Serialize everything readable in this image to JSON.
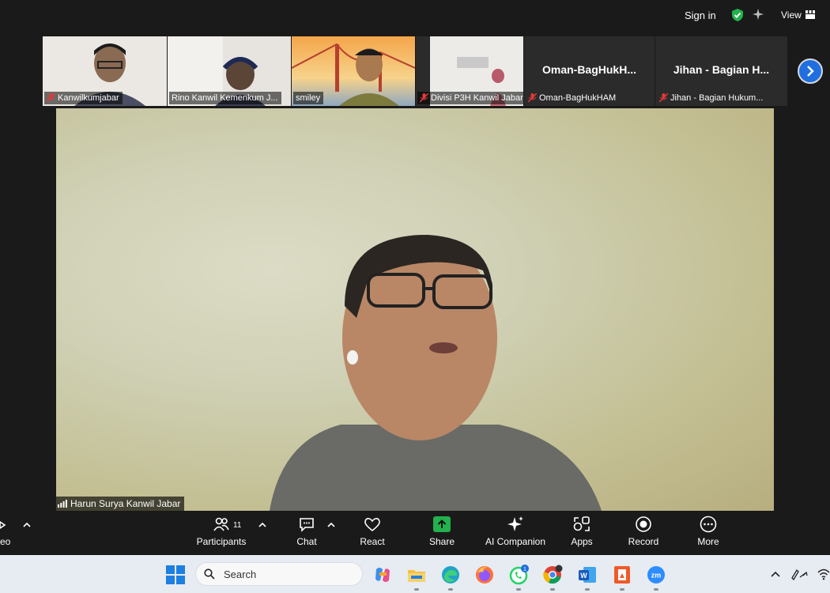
{
  "topbar": {
    "signin": "Sign in",
    "view": "View"
  },
  "thumbnails": [
    {
      "label": "Kanwilkumjabar",
      "muted": true
    },
    {
      "label": "Rino Kanwil Kemenkum J...",
      "muted": false
    },
    {
      "label": "smiley",
      "muted": false
    },
    {
      "label": "Divisi P3H Kanwil Jabar",
      "muted": true
    },
    {
      "label": "Oman-BagHukHAM",
      "bigname": "Oman-BagHukH...",
      "muted": true
    },
    {
      "label": "Jihan - Bagian Hukum...",
      "bigname": "Jihan - Bagian H...",
      "muted": true
    }
  ],
  "main": {
    "speaker": "Harun Surya Kanwil Jabar"
  },
  "toolbar": {
    "video_label": "eo",
    "participants_label": "Participants",
    "participants_count": "11",
    "chat_label": "Chat",
    "react_label": "React",
    "share_label": "Share",
    "ai_label": "AI Companion",
    "apps_label": "Apps",
    "record_label": "Record",
    "more_label": "More"
  },
  "taskbar": {
    "search_placeholder": "Search"
  },
  "colors": {
    "accent_blue": "#1f6fe0",
    "share_green": "#22b14c",
    "bg": "#1a1a1a"
  }
}
